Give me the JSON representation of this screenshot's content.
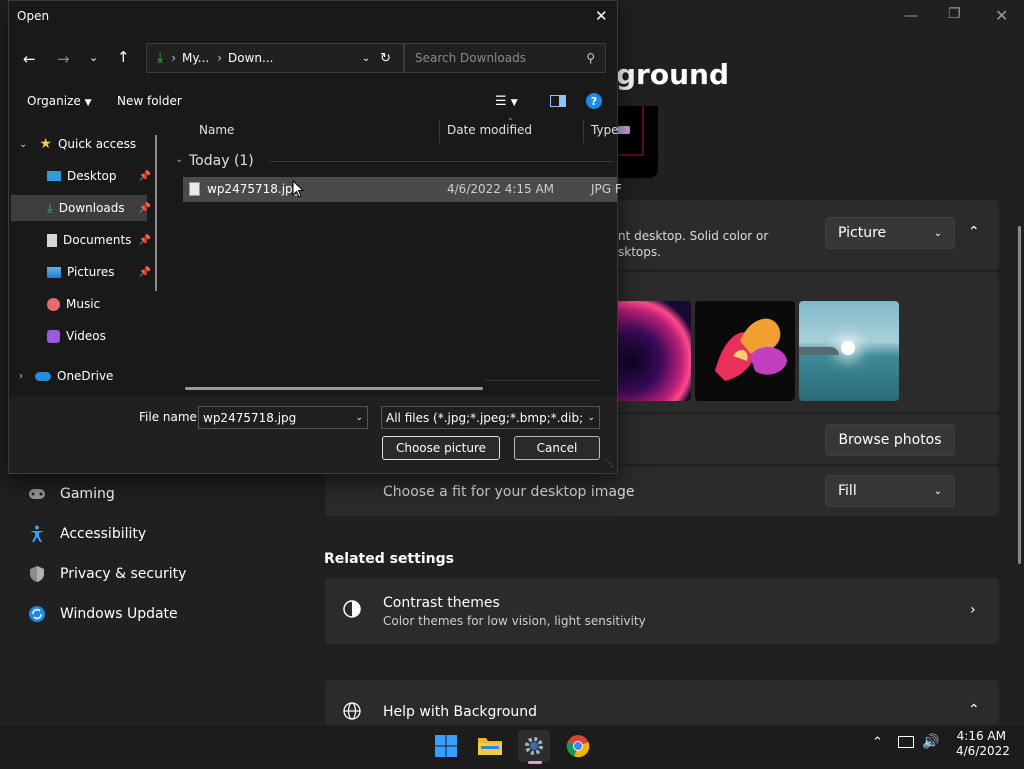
{
  "settings": {
    "title": "Background",
    "title_visible": "ground",
    "personalize_desc_line1": "nt desktop. Solid color or",
    "personalize_desc_line2": "sktops.",
    "background_type": "Picture",
    "browse_label": "Browse photos",
    "fit_label": "Choose a fit for your desktop image",
    "fit_value": "Fill",
    "related_heading": "Related settings",
    "contrast_title": "Contrast themes",
    "contrast_sub": "Color themes for low vision, light sensitivity",
    "help_title": "Help with Background",
    "nav": [
      {
        "label": "Gaming"
      },
      {
        "label": "Accessibility"
      },
      {
        "label": "Privacy & security"
      },
      {
        "label": "Windows Update"
      }
    ]
  },
  "dialog": {
    "title": "Open",
    "address": {
      "part1": "My...",
      "part2": "Down..."
    },
    "search_placeholder": "Search Downloads",
    "organize_label": "Organize",
    "new_folder_label": "New folder",
    "tree": [
      {
        "label": "Quick access"
      },
      {
        "label": "Desktop"
      },
      {
        "label": "Downloads"
      },
      {
        "label": "Documents"
      },
      {
        "label": "Pictures"
      },
      {
        "label": "Music"
      },
      {
        "label": "Videos"
      },
      {
        "label": "OneDrive"
      }
    ],
    "columns": {
      "name": "Name",
      "date": "Date modified",
      "type": "Type"
    },
    "group_label": "Today (1)",
    "file": {
      "name": "wp2475718.jpg",
      "date": "4/6/2022 4:15 AM",
      "type": "JPG F"
    },
    "filename_label": "File name:",
    "filename_value": "wp2475718.jpg",
    "filter_value": "All files (*.jpg;*.jpeg;*.bmp;*.dib;*.png",
    "choose_label": "Choose picture",
    "cancel_label": "Cancel"
  },
  "taskbar": {
    "time": "4:16 AM",
    "date": "4/6/2022"
  },
  "colors": {
    "accent": "#0078d4",
    "dialog_bg": "#191919",
    "selection": "#3d3d3d"
  }
}
